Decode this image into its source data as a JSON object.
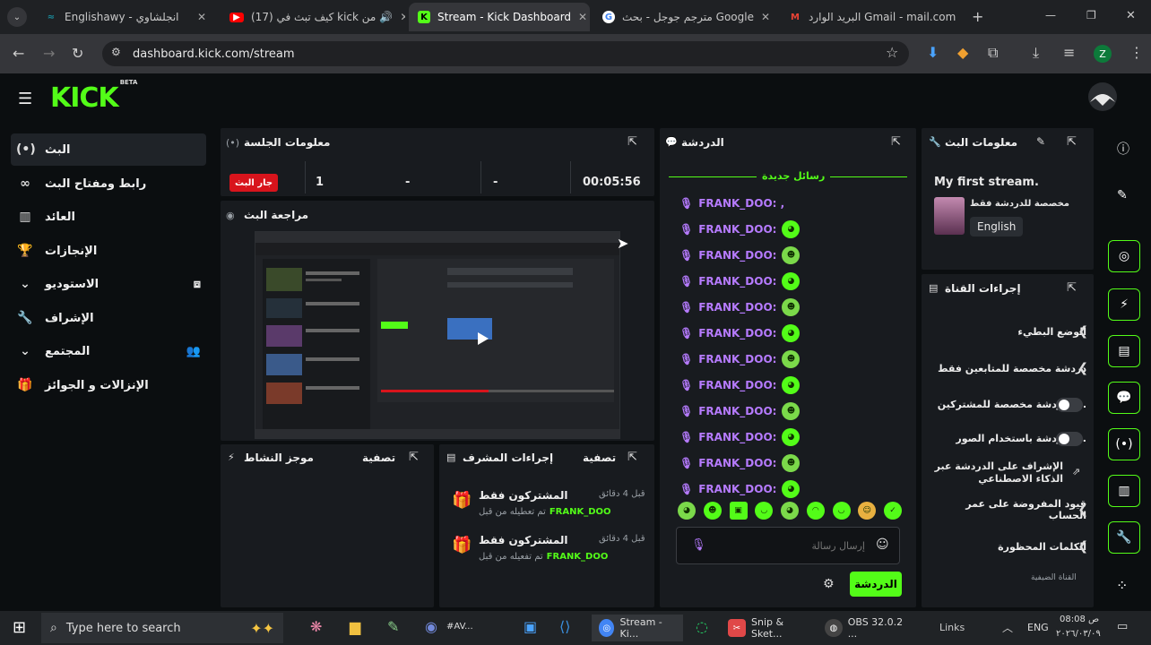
{
  "browser": {
    "tabs": [
      {
        "label": "Englishawy - انجلشاوي",
        "fav_color": "#ffffff",
        "fav_text": "≈"
      },
      {
        "label": "(17) كيف تبث في kick من",
        "fav_color": "#ff0000",
        "fav_text": "▶"
      },
      {
        "label": "Stream - Kick Dashboard",
        "fav_color": "#53fc18",
        "fav_text": "K"
      },
      {
        "label": "مترجم جوجل - بحث Google",
        "fav_color": "#ffffff",
        "fav_text": "G"
      },
      {
        "label": "البريد الوارد Gmail - mail.com",
        "fav_color": "#ffffff",
        "fav_text": "M"
      }
    ],
    "url": "dashboard.kick.com/stream",
    "profile": "Z"
  },
  "kick": {
    "logo": "KICK",
    "logo_badge": "BETA"
  },
  "sidebar": {
    "items": [
      {
        "label": "البث",
        "icon": "broadcast-icon"
      },
      {
        "label": "رابط ومفتاح البث",
        "icon": "link-icon"
      },
      {
        "label": "العائد",
        "icon": "chart-icon"
      },
      {
        "label": "الإنجازات",
        "icon": "trophy-icon"
      },
      {
        "label": "الاستوديو",
        "icon": "chevron-down-icon"
      },
      {
        "label": "الإشراف",
        "icon": "wrench-icon"
      },
      {
        "label": "المجتمع",
        "icon": "chevron-down-icon"
      },
      {
        "label": "الإنزالات و الجوائز",
        "icon": "gift-icon"
      }
    ]
  },
  "session": {
    "title": "معلومات الجلسة",
    "live_badge": "جار البث",
    "viewers": "1",
    "stat2": "-",
    "stat3": "-",
    "duration": "00:05:56"
  },
  "preview": {
    "title": "مراجعة البث"
  },
  "activity": {
    "title": "موجز النشاط",
    "filter": "تصفية"
  },
  "mod_actions": {
    "title": "إجراءات المشرف",
    "filter": "تصفية",
    "items": [
      {
        "title": "المشتركون فقط",
        "time": "قبل 4 دقائق",
        "user": "FRANK_DOO",
        "desc": "تم تعطيله من قبل"
      },
      {
        "title": "المشتركون فقط",
        "time": "قبل 4 دقائق",
        "user": "FRANK_DOO",
        "desc": "تم تفعيله من قبل"
      }
    ]
  },
  "chat": {
    "title": "الدردشة",
    "new_messages": "رسائل جديدة",
    "first_line": "FRANK_DOO: ,",
    "messages": [
      {
        "user": "FRANK_DOO:"
      },
      {
        "user": "FRANK_DOO:"
      },
      {
        "user": "FRANK_DOO:"
      },
      {
        "user": "FRANK_DOO:"
      },
      {
        "user": "FRANK_DOO:"
      },
      {
        "user": "FRANK_DOO:"
      },
      {
        "user": "FRANK_DOO:"
      },
      {
        "user": "FRANK_DOO:"
      },
      {
        "user": "FRANK_DOO:"
      },
      {
        "user": "FRANK_DOO:"
      },
      {
        "user": "FRANK_DOO:"
      }
    ],
    "input_placeholder": "إرسال رسالة",
    "send_label": "الدردشة"
  },
  "stream_info": {
    "title": "معلومات البث",
    "stream_title": "My first stream.",
    "mode": "مخصصة للدردشة فقط",
    "language": "English"
  },
  "channel_actions": {
    "title": "إجراءات القناة",
    "items": [
      {
        "label": "الوضع البطيء",
        "control": "chevron"
      },
      {
        "label": "دردشة مخصصة للمتابعين فقط",
        "control": "chevron"
      },
      {
        "label": "...الدردشة مخصصة للمشتركين",
        "control": "toggle"
      },
      {
        "label": "...الدردشة باستخدام الصور",
        "control": "toggle"
      },
      {
        "label": "الإشراف على الدردشة عبر الذكاء الاصطناعي",
        "control": "link"
      },
      {
        "label": "قيود المفروضة على عمر الحساب",
        "control": "chevron"
      },
      {
        "label": "الكلمات المحظورة",
        "control": "chevron"
      }
    ],
    "section_hint": "القناة الضيفية"
  },
  "taskbar": {
    "search_placeholder": "Type here to search",
    "apps": [
      {
        "label": "Stream - Ki...",
        "color": "#4285f4"
      },
      {
        "label": "Snip & Sket...",
        "color": "#e04848"
      },
      {
        "label": "OBS 32.0.2 ...",
        "color": "#444444"
      }
    ],
    "links": "Links",
    "lang": "ENG",
    "time": "08:08 ص",
    "date": "٢٠٢٦/٠٣/٠٩"
  }
}
